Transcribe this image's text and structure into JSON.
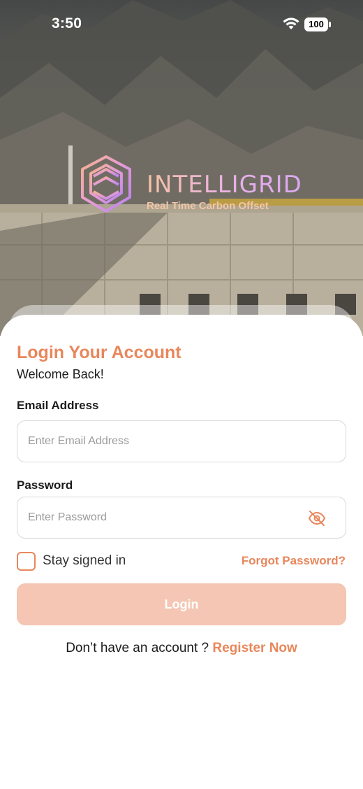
{
  "status_bar": {
    "time": "3:50",
    "battery": "100",
    "icons": [
      "wifi-icon",
      "battery-icon"
    ]
  },
  "brand": {
    "name": "INTELLIGRID",
    "tagline": "Real Time Carbon Offset"
  },
  "login": {
    "title": "Login Your Account",
    "subtitle": "Welcome Back!",
    "email": {
      "label": "Email Address",
      "placeholder": "Enter Email Address",
      "value": ""
    },
    "password": {
      "label": "Password",
      "placeholder": "Enter Password",
      "value": "",
      "toggle_icon": "eye-off-icon"
    },
    "stay_signed_in": {
      "label": "Stay signed in",
      "checked": false
    },
    "forgot_password": "Forgot Password?",
    "login_button": "Login",
    "register_prompt": "Don’t have an account ?",
    "register_link": "Register Now"
  },
  "colors": {
    "accent": "#e8875c",
    "button_disabled": "#f4c6b3",
    "text": "#1b1b1b",
    "border": "#d9d9d9"
  }
}
